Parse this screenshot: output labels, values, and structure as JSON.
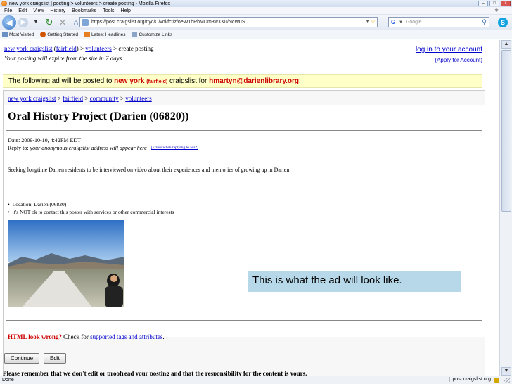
{
  "window": {
    "title": "new york craigslist | posting > volunteers > create posting - Mozilla Firefox"
  },
  "menu": [
    "File",
    "Edit",
    "View",
    "History",
    "Bookmarks",
    "Tools",
    "Help"
  ],
  "nav": {
    "url": "https://post.craigslist.org/nyc/C/vol/fct/z/oeW1bRhMDm3wXKu/NcWuS",
    "search_placeholder": "Google"
  },
  "bookmarks": [
    {
      "label": "Most Visited",
      "color": "#6a8fc5"
    },
    {
      "label": "Getting Started",
      "color": "#d35400"
    },
    {
      "label": "Latest Headlines",
      "color": "#e67e22"
    },
    {
      "label": "Customize Links",
      "color": "#8aa5c8"
    }
  ],
  "page": {
    "crumb_site": "new york craigslist",
    "crumb_area": "fairfield",
    "crumb_section": "volunteers",
    "crumb_action": "create posting",
    "crumb_sep": ">",
    "expire_note": "Your posting will expire from the site in 7 days.",
    "login_link": "log in to your account",
    "apply_link": "Apply for Account",
    "notice_pre": "The following ad will be posted to",
    "notice_city": "new york",
    "notice_area": "(fairfield)",
    "notice_mid": "craigslist for",
    "notice_email": "hmartyn@darienlibrary.org",
    "box_crumbs": [
      "new york craigslist",
      "fairfield",
      "community",
      "volunteers"
    ],
    "post_title": "Oral History Project (Darien (06820))",
    "date_line": "Date: 2009-10-10, 4:42PM EDT",
    "reply_label": "Reply to:",
    "reply_value": "your anonymous craigslist address will appear here",
    "reply_tip": "[Errors when replying to ads?]",
    "body": "Seeking longtime Darien residents to be interviewed on video about their experiences and memories of growing up in Darien.",
    "bullets": [
      "Location: Darien (06820)",
      "it's NOT ok to contact this poster with services or other commercial interests"
    ],
    "html_wrong_red": "HTML look wrong?",
    "html_wrong_mid": "Check for",
    "html_wrong_link": "supported tags and attributes",
    "continue_btn": "Continue",
    "edit_btn": "Edit",
    "remember": "Please remember that we don't edit or proofread your posting and that the responsibility for the content is yours."
  },
  "callout": "This is what the ad will look like.",
  "status": {
    "left": "Done",
    "host": "post.craigslist.org"
  },
  "colors": {
    "link": "#0000cc",
    "notice_bg": "#ffffc8",
    "callout_bg": "#b6d8e8",
    "red": "#cc0000"
  }
}
